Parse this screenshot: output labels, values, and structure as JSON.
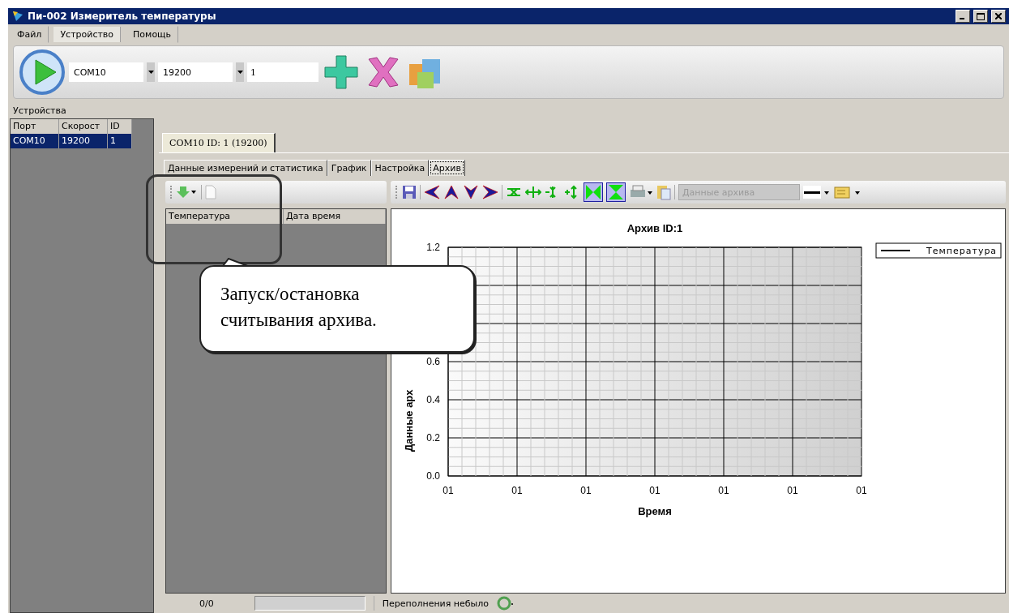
{
  "window": {
    "title": "Пи-002 Измеритель температуры"
  },
  "menu": [
    {
      "label": "Файл",
      "selected": false
    },
    {
      "label": "Устройство",
      "selected": true
    },
    {
      "label": "Помощь",
      "selected": false
    }
  ],
  "toolbar": {
    "port": "COM10",
    "speed": "19200",
    "id": "1"
  },
  "devices": {
    "title": "Устройства",
    "columns": [
      "Порт",
      "Скорост",
      "ID"
    ],
    "rows": [
      {
        "cells": [
          "COM10",
          "19200",
          "1"
        ],
        "selected": true
      }
    ]
  },
  "document_tabs": [
    {
      "label": "COM10 ID: 1 (19200)",
      "selected": true
    }
  ],
  "tabs": [
    {
      "label": "Данные измерений и статистика",
      "selected": false
    },
    {
      "label": "График",
      "selected": false
    },
    {
      "label": "Настройка",
      "selected": false
    },
    {
      "label": "Архив",
      "selected": true
    }
  ],
  "archive_list": {
    "columns": [
      "Температура",
      "Дата время"
    ]
  },
  "chart_toolbar": {
    "series_select": {
      "placeholder": "Данные архива",
      "disabled": true
    }
  },
  "chart": {
    "chart_data": {
      "type": "line",
      "title": "Архив ID:1",
      "xlabel": "Время",
      "ylabel": "Данные арх",
      "categories": [
        "01",
        "01",
        "01",
        "01",
        "01",
        "01",
        "01"
      ],
      "series": [
        {
          "name": "Температура",
          "color": "#000000",
          "values": [
            null,
            null,
            null,
            null,
            null,
            null,
            null
          ]
        }
      ],
      "ylim": [
        0,
        1.2
      ],
      "grid": true,
      "yticks": [
        {
          "value": 0,
          "label": "0.0"
        },
        {
          "value": 0.2,
          "label": "0.2"
        },
        {
          "value": 0.4,
          "label": "0.4"
        },
        {
          "value": 0.6,
          "label": "0.6"
        },
        {
          "value": 1.2,
          "label": "1.2"
        }
      ]
    }
  },
  "status_bar": {
    "counter": "0/0",
    "progress": {
      "level": 0
    },
    "message": "Переполнения небыло"
  },
  "callout": {
    "text": "Запуск/остановка считывания архива."
  }
}
